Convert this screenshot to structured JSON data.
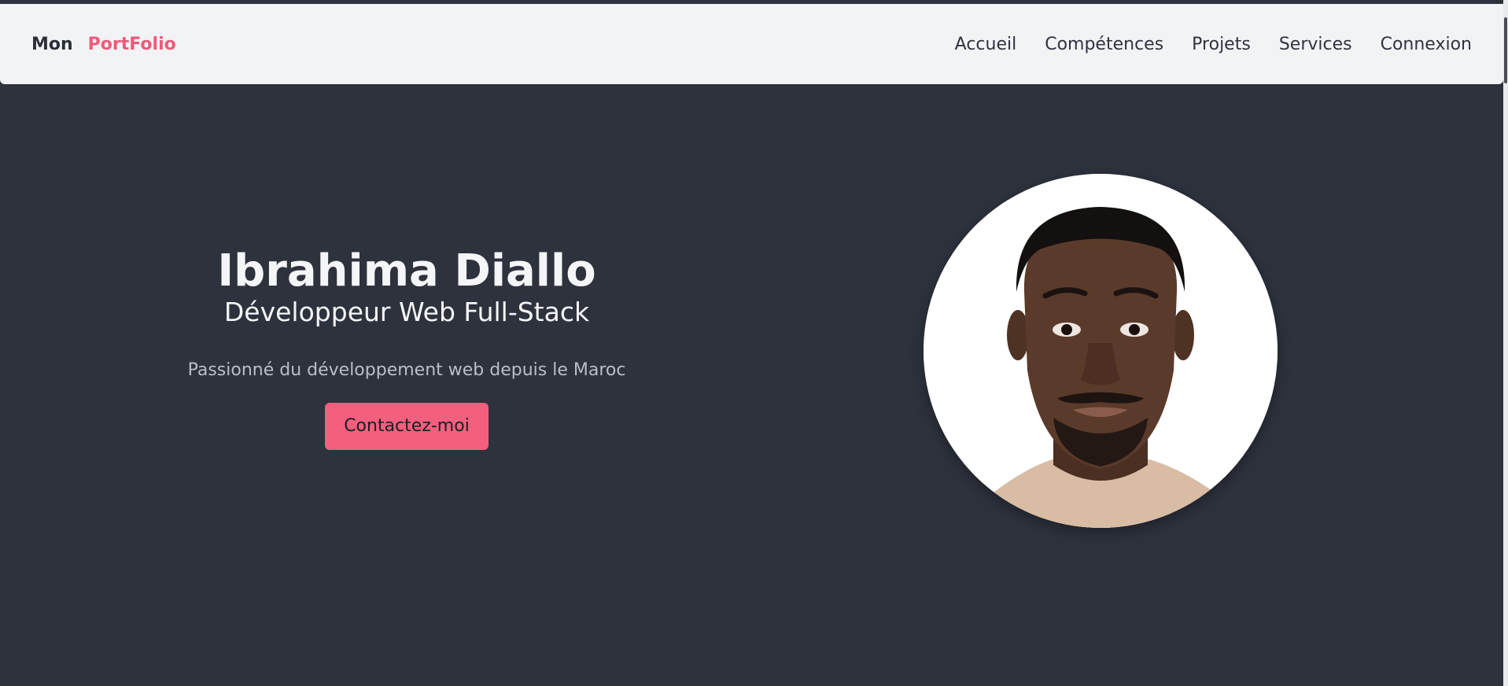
{
  "navbar": {
    "brand_mon": "Mon",
    "brand_portfolio": "PortFolio",
    "links": [
      "Accueil",
      "Compétences",
      "Projets",
      "Services",
      "Connexion"
    ]
  },
  "hero": {
    "name": "Ibrahima Diallo",
    "role": "Développeur Web Full-Stack",
    "tagline": "Passionné du développement web depuis le Maroc",
    "cta_label": "Contactez-moi"
  },
  "colors": {
    "background": "#2e323d",
    "navbar": "#f2f3f5",
    "accent": "#f45f7e",
    "brand_accent": "#f0597a"
  },
  "icons": {
    "avatar": "profile-photo"
  }
}
